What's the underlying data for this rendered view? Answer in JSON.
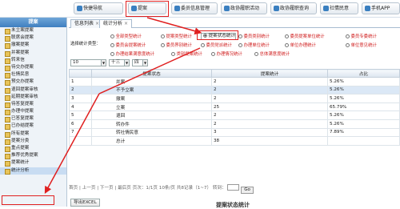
{
  "topbar": {
    "buttons": [
      {
        "label": "快捷导航"
      },
      {
        "label": "提案"
      },
      {
        "label": "委员信息管理"
      },
      {
        "label": "政协履职活动"
      },
      {
        "label": "政协履职查询"
      },
      {
        "label": "社情民意"
      },
      {
        "label": "手机APP"
      }
    ]
  },
  "sidebar": {
    "header": "提案",
    "items": [
      {
        "label": "未立案提案"
      },
      {
        "label": "联席会提案"
      },
      {
        "label": "撤案提案"
      },
      {
        "label": "并案提案"
      },
      {
        "label": "转来信"
      },
      {
        "label": "待交办提案"
      },
      {
        "label": "社情民意"
      },
      {
        "label": "预交办提案"
      },
      {
        "label": "退回提案审核"
      },
      {
        "label": "延期提案审核"
      },
      {
        "label": "待答复提案"
      },
      {
        "label": "办理中提案"
      },
      {
        "label": "已答复提案"
      },
      {
        "label": "已办结提案"
      },
      {
        "label": "所有提案"
      },
      {
        "label": "提案分类"
      },
      {
        "label": "重点提案"
      },
      {
        "label": "推荐优秀提案"
      },
      {
        "label": "提案统计"
      },
      {
        "label": "统计分析"
      }
    ]
  },
  "tabs": [
    {
      "label": "信息列表"
    },
    {
      "label": "统计分析"
    }
  ],
  "filter": {
    "label": "选择统计类型：",
    "options": [
      {
        "label": "全部类型统计"
      },
      {
        "label": "提案类型统计"
      },
      {
        "label": "提案状态统计"
      },
      {
        "label": "委员类别统计"
      },
      {
        "label": "委员提案单位统计"
      },
      {
        "label": "委员专委统计"
      },
      {
        "label": "委员会提案统计"
      },
      {
        "label": "委员界别统计"
      },
      {
        "label": "委员党派统计"
      },
      {
        "label": "办理单位统计"
      },
      {
        "label": "单位办理统计"
      },
      {
        "label": "单位意见统计"
      },
      {
        "label": "办理结果满意度统计"
      },
      {
        "label": "类别提案统计"
      },
      {
        "label": "办理情况统计"
      },
      {
        "label": "总体满意度统计"
      }
    ],
    "selected_index": 2
  },
  "selects": {
    "session": "10",
    "term": "十三",
    "round": "四"
  },
  "table": {
    "headers": [
      "",
      "提案状态",
      "提案统计",
      "占比"
    ],
    "rows": [
      {
        "no": "1",
        "status": "并案",
        "count": "2",
        "pct": "5.26%"
      },
      {
        "no": "2",
        "status": "不予立案",
        "count": "2",
        "pct": "5.26%"
      },
      {
        "no": "3",
        "status": "撤案",
        "count": "2",
        "pct": "5.26%"
      },
      {
        "no": "4",
        "status": "立案",
        "count": "25",
        "pct": "65.79%"
      },
      {
        "no": "5",
        "status": "退回",
        "count": "2",
        "pct": "5.26%"
      },
      {
        "no": "6",
        "status": "转办件",
        "count": "2",
        "pct": "5.26%"
      },
      {
        "no": "7",
        "status": "转社情民意",
        "count": "3",
        "pct": "7.89%"
      },
      {
        "no": "",
        "status": "总计",
        "count": "38",
        "pct": ""
      }
    ]
  },
  "pager": {
    "text": "首页 | 上一页 | 下一页 | 最后页  页次：1/1页 10条/页 共8记录（1~7）  转到：",
    "go": "Go"
  },
  "export_label": "导出EXCEL",
  "bottom_title": "提案状态统计"
}
